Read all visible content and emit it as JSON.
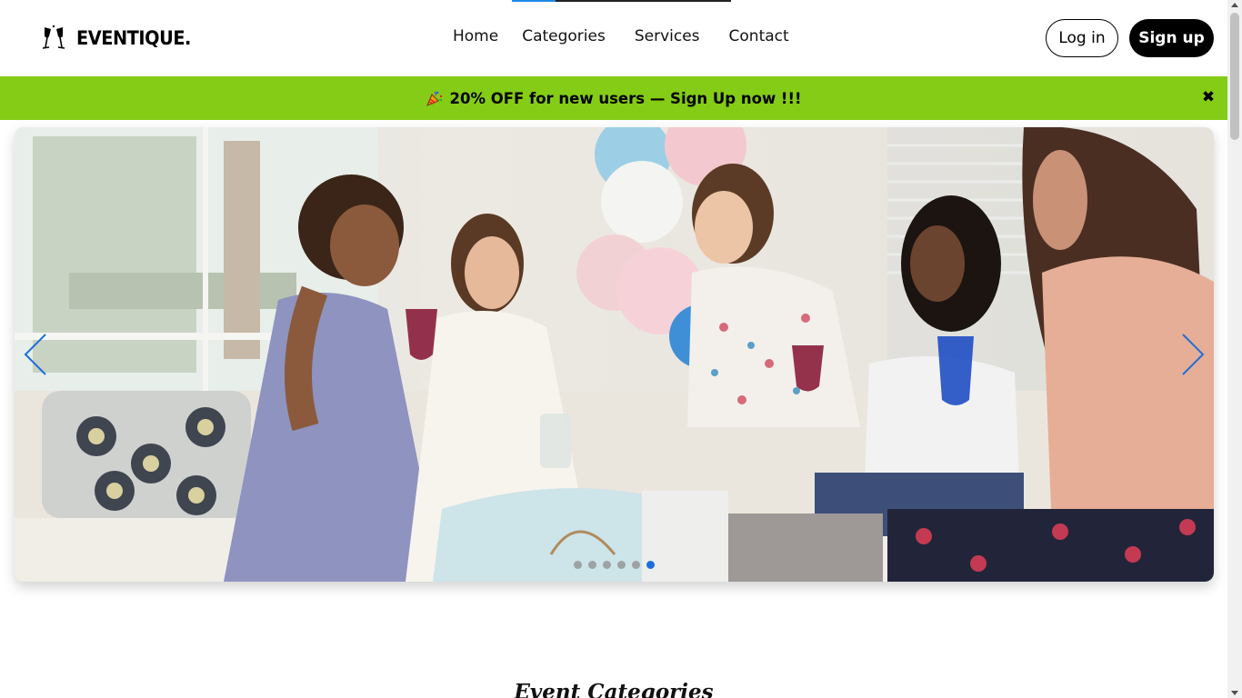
{
  "header": {
    "logo_text": "EVENTIQUE.",
    "logo_icon": "champagne-glasses-icon",
    "nav": [
      {
        "label": "Home"
      },
      {
        "label": "Categories"
      },
      {
        "label": "Services"
      },
      {
        "label": "Contact"
      }
    ],
    "login_label": "Log in",
    "signup_label": "Sign up"
  },
  "loading_progress": 0.2,
  "promo": {
    "icon": "party-popper-icon",
    "text": "20% OFF for new users — Sign Up now !!!",
    "close_icon": "close-icon",
    "color": "#84cc16"
  },
  "carousel": {
    "image_alt": "Group of women celebrating at a baby shower",
    "prev_icon": "chevron-left-icon",
    "next_icon": "chevron-right-icon",
    "slide_count": 6,
    "active_index": 5,
    "accent": "#1e6fd9"
  },
  "section": {
    "title": "Event Categories"
  }
}
